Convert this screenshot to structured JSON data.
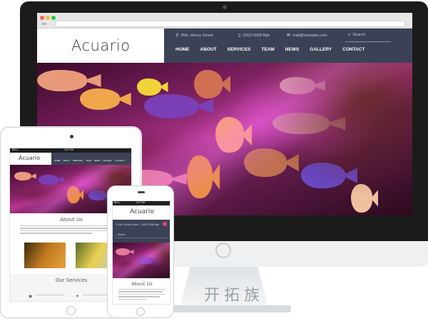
{
  "watermark": "开拓族",
  "site": {
    "logo": "Acuario",
    "contact": {
      "address": "45A, Honey Street",
      "phone": "(33)3 0068 Bgh",
      "email": "mail@example.com",
      "search_placeholder": "Search"
    },
    "menu": [
      "HOME",
      "ABOUT",
      "SERVICES",
      "TEAM",
      "NEWS",
      "GALLERY",
      "CONTACT"
    ]
  },
  "tablet": {
    "status_time": "4:21 PM",
    "status_carrier": "BELL",
    "about_heading": "About Us",
    "services_heading": "Our Services"
  },
  "phone": {
    "status_time": "4:21 PM",
    "status_carrier": "BELL",
    "logo": "Acuario",
    "about_heading": "About Us"
  },
  "icons": {
    "location": "map-pin-icon",
    "phone": "phone-icon",
    "email": "mail-icon",
    "search": "search-icon"
  },
  "colors": {
    "nav_bg": "#3c4255",
    "aquarium_pink": "#b4378f"
  }
}
